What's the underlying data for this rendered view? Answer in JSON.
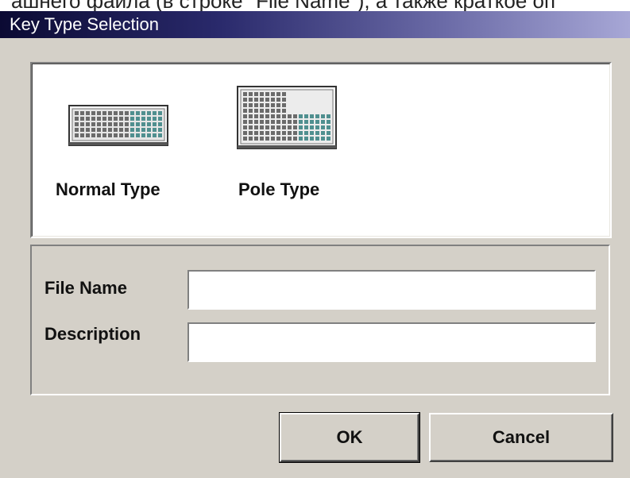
{
  "background_caption": "ашнего файла (в строке \"File Name\"), а также краткое оп",
  "window": {
    "title": "Key Type Selection"
  },
  "key_types": [
    {
      "label": "Normal Type",
      "icon": "normal-keyboard-icon"
    },
    {
      "label": "Pole Type",
      "icon": "pole-keyboard-icon"
    }
  ],
  "form": {
    "file_name_label": "File Name",
    "file_name_value": "",
    "description_label": "Description",
    "description_value": ""
  },
  "buttons": {
    "ok": "OK",
    "cancel": "Cancel"
  },
  "colors": {
    "dialog_face": "#d4d0c8",
    "title_gradient_start": "#0b0a33",
    "title_gradient_end": "#a7a7d6",
    "panel_background": "#ffffff"
  }
}
